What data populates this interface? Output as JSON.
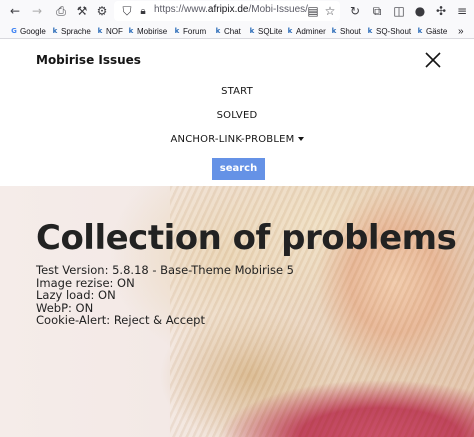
{
  "browser": {
    "url_prefix": "https://www.",
    "url_host": "afripix.de",
    "url_path": "/Mobi-Issues/",
    "bookmarks": [
      {
        "label": "Google",
        "icon": "google-icon"
      },
      {
        "label": "Sprache",
        "icon": "site-favicon"
      },
      {
        "label": "NOF",
        "icon": "site-favicon"
      },
      {
        "label": "Mobirise",
        "icon": "site-favicon"
      },
      {
        "label": "Forum",
        "icon": "site-favicon"
      },
      {
        "label": "Chat",
        "icon": "site-favicon"
      },
      {
        "label": "SQLite",
        "icon": "site-favicon"
      },
      {
        "label": "Adminer",
        "icon": "site-favicon"
      },
      {
        "label": "Shout",
        "icon": "site-favicon"
      },
      {
        "label": "SQ-Shout",
        "icon": "site-favicon"
      },
      {
        "label": "Gäste",
        "icon": "site-favicon"
      }
    ]
  },
  "menu": {
    "brand": "Mobirise Issues",
    "items": [
      {
        "label": "START"
      },
      {
        "label": "SOLVED"
      },
      {
        "label": "ANCHOR-LINK-PROBLEM"
      }
    ],
    "search_label": "search",
    "accent_color": "#6592e6"
  },
  "hero": {
    "title": "Collection of problems",
    "lines": [
      "Test Version: 5.8.18 - Base-Theme Mobirise 5",
      "Image rezise: ON",
      "Lazy load: ON",
      "WebP: ON",
      "Cookie-Alert: Reject & Accept"
    ]
  }
}
